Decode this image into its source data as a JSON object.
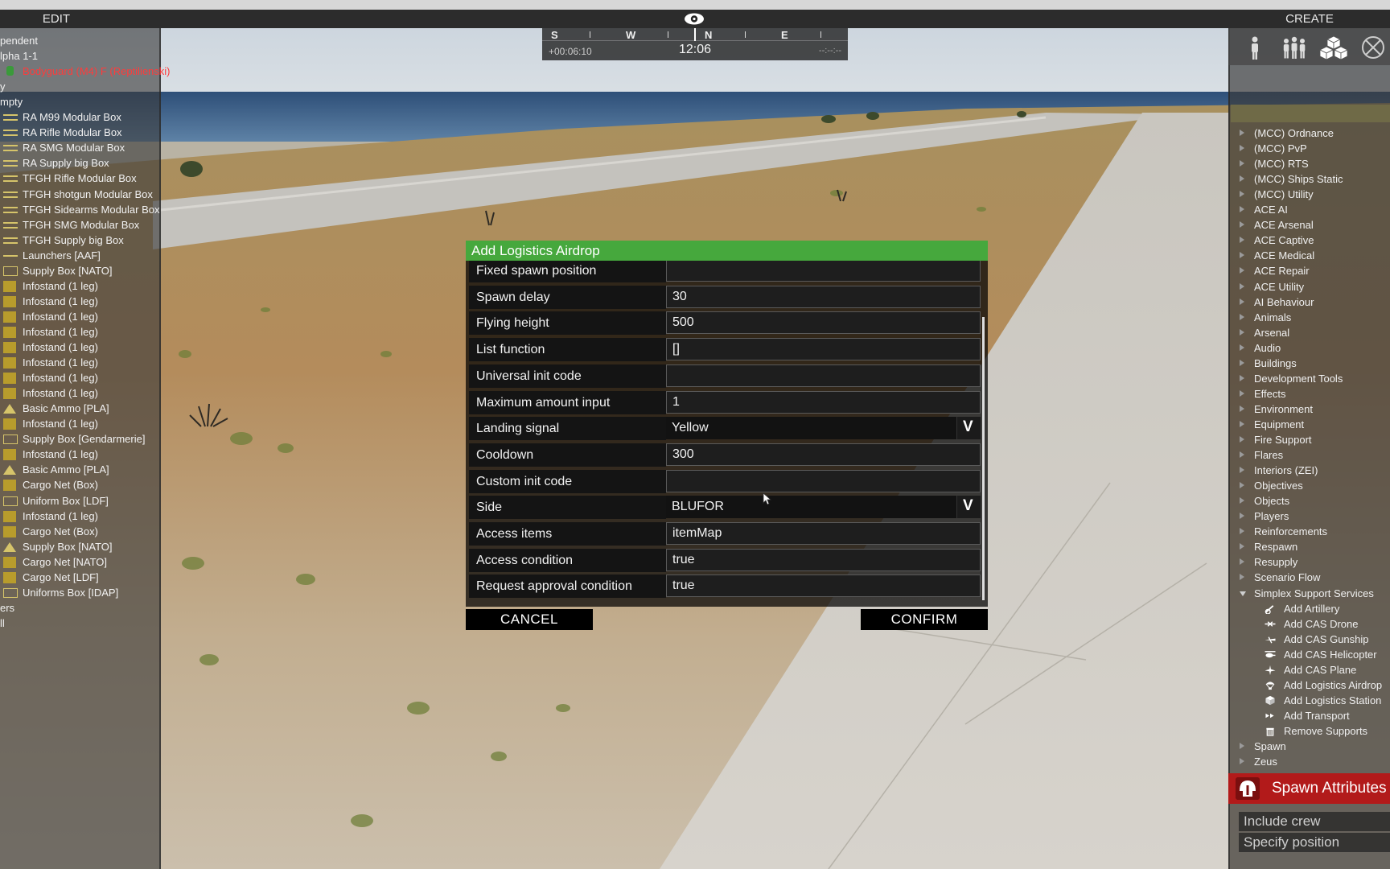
{
  "top_bar": {
    "edit_label": "EDIT",
    "create_label": "CREATE"
  },
  "compass": {
    "letters": [
      "S",
      "W",
      "N",
      "E"
    ],
    "elapsed": "+00:06:10",
    "time": "12:06",
    "right_readout": "--:--:--"
  },
  "edit_panel": {
    "rows": [
      {
        "text": "pendent",
        "icon": "none",
        "style": "normal"
      },
      {
        "text": "lpha 1-1",
        "icon": "none",
        "style": "normal"
      },
      {
        "text": "Bodyguard (M4) F (Reptilienski)",
        "icon": "unit",
        "style": "red"
      },
      {
        "text": "y",
        "icon": "none",
        "style": "normal"
      },
      {
        "text": "mpty",
        "icon": "none",
        "style": "normal"
      },
      {
        "text": "RA M99 Modular Box",
        "icon": "bar",
        "style": "normal"
      },
      {
        "text": "RA Rifle Modular Box",
        "icon": "bar",
        "style": "normal"
      },
      {
        "text": "RA SMG Modular Box",
        "icon": "bar",
        "style": "normal"
      },
      {
        "text": "RA Supply big Box",
        "icon": "bar",
        "style": "normal"
      },
      {
        "text": "TFGH Rifle Modular Box",
        "icon": "bar",
        "style": "normal"
      },
      {
        "text": "TFGH shotgun Modular Box",
        "icon": "bar",
        "style": "normal"
      },
      {
        "text": "TFGH Sidearms Modular Box",
        "icon": "bar",
        "style": "normal"
      },
      {
        "text": "TFGH SMG Modular Box",
        "icon": "bar",
        "style": "normal"
      },
      {
        "text": "TFGH Supply big Box",
        "icon": "bar",
        "style": "normal"
      },
      {
        "text": "Launchers [AAF]",
        "icon": "line",
        "style": "normal"
      },
      {
        "text": "Supply Box [NATO]",
        "icon": "box",
        "style": "normal"
      },
      {
        "text": "Infostand (1 leg)",
        "icon": "block",
        "style": "normal"
      },
      {
        "text": "Infostand (1 leg)",
        "icon": "block",
        "style": "normal"
      },
      {
        "text": "Infostand (1 leg)",
        "icon": "block",
        "style": "normal"
      },
      {
        "text": "Infostand (1 leg)",
        "icon": "block",
        "style": "normal"
      },
      {
        "text": "Infostand (1 leg)",
        "icon": "block",
        "style": "normal"
      },
      {
        "text": "Infostand (1 leg)",
        "icon": "block",
        "style": "normal"
      },
      {
        "text": "Infostand (1 leg)",
        "icon": "block",
        "style": "normal"
      },
      {
        "text": "Infostand (1 leg)",
        "icon": "block",
        "style": "normal"
      },
      {
        "text": "Basic Ammo [PLA]",
        "icon": "tri",
        "style": "normal"
      },
      {
        "text": "Infostand (1 leg)",
        "icon": "block",
        "style": "normal"
      },
      {
        "text": "Supply Box [Gendarmerie]",
        "icon": "box",
        "style": "normal"
      },
      {
        "text": "Infostand (1 leg)",
        "icon": "block",
        "style": "normal"
      },
      {
        "text": "Basic Ammo [PLA]",
        "icon": "tri",
        "style": "normal"
      },
      {
        "text": "Cargo Net (Box)",
        "icon": "block",
        "style": "normal"
      },
      {
        "text": "Uniform Box [LDF]",
        "icon": "box",
        "style": "normal"
      },
      {
        "text": "Infostand (1 leg)",
        "icon": "block",
        "style": "normal"
      },
      {
        "text": "Cargo Net (Box)",
        "icon": "block",
        "style": "normal"
      },
      {
        "text": "Supply Box [NATO]",
        "icon": "tri",
        "style": "normal"
      },
      {
        "text": "Cargo Net [NATO]",
        "icon": "block",
        "style": "normal"
      },
      {
        "text": "Cargo Net [LDF]",
        "icon": "block",
        "style": "normal"
      },
      {
        "text": "Uniforms Box [IDAP]",
        "icon": "box",
        "style": "normal"
      },
      {
        "text": "ers",
        "icon": "none",
        "style": "normal"
      },
      {
        "text": "ll",
        "icon": "none",
        "style": "normal"
      }
    ]
  },
  "create_panel": {
    "tabs": [
      "units-tab",
      "groups-tab",
      "props-tab",
      "none-tab"
    ],
    "categories": [
      "(MCC) Ordnance",
      "(MCC) PvP",
      "(MCC) RTS",
      "(MCC) Ships Static",
      "(MCC) Utility",
      "ACE AI",
      "ACE Arsenal",
      "ACE Captive",
      "ACE Medical",
      "ACE Repair",
      "ACE Utility",
      "AI Behaviour",
      "Animals",
      "Arsenal",
      "Audio",
      "Buildings",
      "Development Tools",
      "Effects",
      "Environment",
      "Equipment",
      "Fire Support",
      "Flares",
      "Interiors (ZEI)",
      "Objectives",
      "Objects",
      "Players",
      "Reinforcements",
      "Respawn",
      "Resupply",
      "Scenario Flow",
      "Simplex Support Services"
    ],
    "expanded_category": "Simplex Support Services",
    "sub_items": [
      {
        "label": "Add Artillery",
        "icon": "artillery-icon"
      },
      {
        "label": "Add CAS Drone",
        "icon": "drone-icon"
      },
      {
        "label": "Add CAS Gunship",
        "icon": "gunship-icon"
      },
      {
        "label": "Add CAS Helicopter",
        "icon": "helicopter-icon"
      },
      {
        "label": "Add CAS Plane",
        "icon": "plane-icon"
      },
      {
        "label": "Add Logistics Airdrop",
        "icon": "parachute-icon"
      },
      {
        "label": "Add Logistics Station",
        "icon": "crate-icon"
      },
      {
        "label": "Add Transport",
        "icon": "transport-icon"
      },
      {
        "label": "Remove Supports",
        "icon": "trash-icon"
      }
    ],
    "trailing_categories": [
      "Spawn",
      "Zeus"
    ],
    "spawn_attributes": {
      "title": "Spawn Attributes",
      "options": [
        "Include crew",
        "Specify position"
      ]
    }
  },
  "dialog": {
    "title": "Add Logistics Airdrop",
    "title_color": "#46a83d",
    "fields": [
      {
        "label": "Fixed spawn position",
        "type": "text",
        "value": ""
      },
      {
        "label": "Spawn delay",
        "type": "text",
        "value": "30"
      },
      {
        "label": "Flying height",
        "type": "text",
        "value": "500"
      },
      {
        "label": "List function",
        "type": "text",
        "value": "[]"
      },
      {
        "label": "Universal init code",
        "type": "text",
        "value": ""
      },
      {
        "label": "Maximum amount input",
        "type": "text",
        "value": "1"
      },
      {
        "label": "Landing signal",
        "type": "select",
        "value": "Yellow"
      },
      {
        "label": "Cooldown",
        "type": "text",
        "value": "300"
      },
      {
        "label": "Custom init code",
        "type": "text",
        "value": ""
      },
      {
        "label": "Side",
        "type": "select",
        "value": "BLUFOR"
      },
      {
        "label": "Access items",
        "type": "text",
        "value": "itemMap"
      },
      {
        "label": "Access condition",
        "type": "text",
        "value": "true"
      },
      {
        "label": "Request approval condition",
        "type": "text",
        "value": "true"
      }
    ],
    "select_arrow_glyph": "V",
    "cancel_label": "CANCEL",
    "confirm_label": "CONFIRM"
  }
}
